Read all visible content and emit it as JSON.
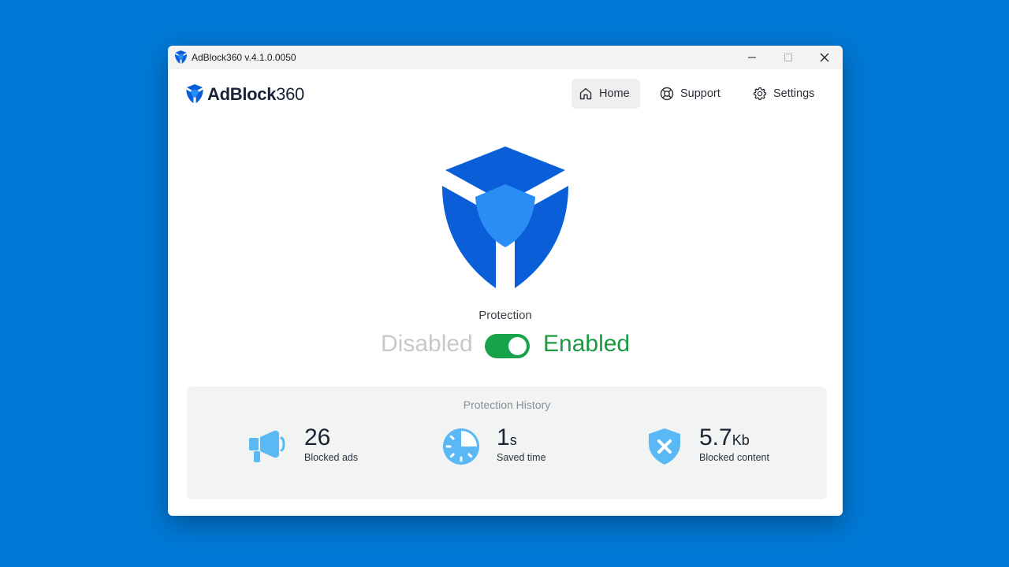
{
  "window": {
    "title": "AdBlock360 v.4.1.0.0050"
  },
  "brand": {
    "bold": "AdBlock",
    "light": "360"
  },
  "nav": [
    {
      "label": "Home",
      "icon": "home-icon",
      "active": true
    },
    {
      "label": "Support",
      "icon": "lifebuoy-icon"
    },
    {
      "label": "Settings",
      "icon": "gear-icon"
    }
  ],
  "protection": {
    "label": "Protection",
    "off": "Disabled",
    "on": "Enabled",
    "enabled": true
  },
  "history": {
    "title": "Protection History",
    "stats": [
      {
        "value": "26",
        "unit": "",
        "caption": "Blocked ads",
        "icon": "megaphone-icon"
      },
      {
        "value": "1",
        "unit": "s",
        "caption": "Saved time",
        "icon": "clock-icon"
      },
      {
        "value": "5.7",
        "unit": "Kb",
        "caption": "Blocked content",
        "icon": "shield-x-icon"
      }
    ]
  },
  "colors": {
    "background": "#0179d6",
    "accent": "#0a5fd8",
    "enabled": "#16a34a",
    "icon_light": "#5ab9f5"
  }
}
